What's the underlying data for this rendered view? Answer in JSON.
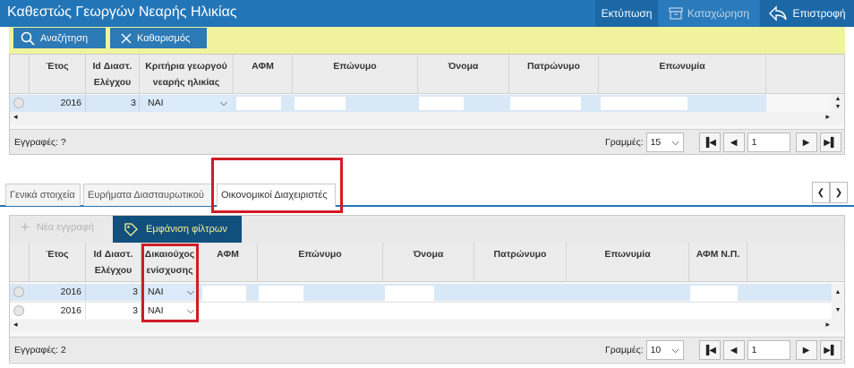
{
  "header": {
    "title": "Καθεστώς Γεωργών Νεαρής Ηλικίας",
    "print_label": "Εκτύπωση",
    "save_label": "Καταχώρηση",
    "back_label": "Επιστροφή"
  },
  "filters": {
    "search_label": "Αναζήτηση",
    "clear_label": "Καθαρισμός"
  },
  "grid1": {
    "columns": [
      "Έτος",
      "Id Διαστ. Ελέγχου",
      "Κριτήρια γεωργού νεαρής ηλικίας",
      "ΑΦΜ",
      "Επώνυμο",
      "Όνομα",
      "Πατρώνυμο",
      "Επωνυμία"
    ],
    "rows": [
      {
        "year": "2016",
        "id": "3",
        "criteria": "ΝΑΙ"
      }
    ],
    "records_label": "Εγγραφές: ?",
    "rows_label": "Γραμμές:",
    "page_size": "15",
    "page": "1"
  },
  "tabs": [
    {
      "label": "Γενικά στοιχεία"
    },
    {
      "label": "Ευρήματα Διασταυρωτικού"
    },
    {
      "label": "Οικονομικοί Διαχειριστές"
    }
  ],
  "grid2": {
    "new_label": "Νέα εγγραφή",
    "filters_label": "Εμφάνιση φίλτρων",
    "columns": [
      "Έτος",
      "Id Διαστ. Ελέγχου",
      "Δικαιούχος ενίσχυσης",
      "ΑΦΜ",
      "Επώνυμο",
      "Όνομα",
      "Πατρώνυμο",
      "Επωνυμία",
      "ΑΦΜ Ν.Π."
    ],
    "rows": [
      {
        "year": "2016",
        "id": "3",
        "beneficiary": "ΝΑΙ"
      },
      {
        "year": "2016",
        "id": "3",
        "beneficiary": "ΝΑΙ"
      }
    ],
    "records_label": "Εγγραφές: 2",
    "rows_label": "Γραμμές:",
    "page_size": "10",
    "page": "1"
  },
  "icons": {
    "print": "printer-icon",
    "save": "save-box-icon",
    "back": "return-arrow-icon",
    "search": "search-icon",
    "clear": "close-icon",
    "add": "plus-icon",
    "filter": "tag-icon"
  },
  "colors": {
    "header_blue": "#2276b8",
    "toolbar_yellow": "#f0f39c",
    "button_blue": "#2c7ab6",
    "dark_tab": "#114f7d",
    "highlight_red": "#d01c25",
    "row_selected": "#d9e8f6"
  }
}
